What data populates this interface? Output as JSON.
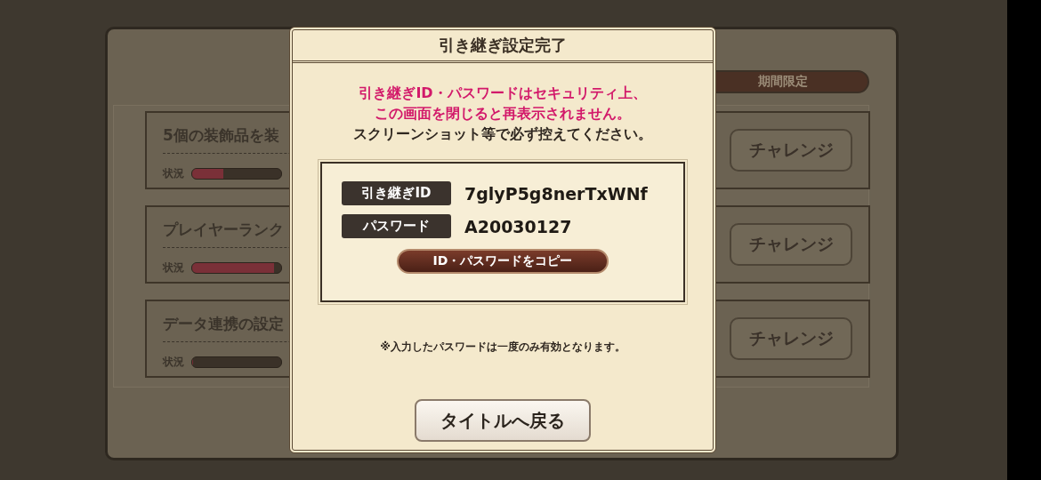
{
  "background": {
    "tab": {
      "label": "期間限定",
      "selected": true
    },
    "missions": [
      {
        "title": "5個の装飾品を装",
        "status_label": "状況",
        "level": 0.35,
        "button": "チャレンジ"
      },
      {
        "title": "プレイヤーランク",
        "status_label": "状況",
        "level": 0.92,
        "button": "チャレンジ"
      },
      {
        "title": "データ連携の設定",
        "status_label": "状況",
        "level": 0,
        "button": "チャレンジ"
      }
    ]
  },
  "dialog": {
    "title": "引き継ぎ設定完了",
    "warning_lines": [
      "引き継ぎID・パスワードはセキュリティ上、",
      "この画面を閉じると再表示されません。"
    ],
    "instruction": "スクリーンショット等で必ず控えてください。",
    "credentials": [
      {
        "label": "引き継ぎID",
        "value": "7glyP5g8nerTxWNf"
      },
      {
        "label": "パスワード",
        "value": "A20030127"
      }
    ],
    "copy_button": "ID・パスワードをコピー",
    "note": "※入力したパスワードは一度のみ有効となります。",
    "back_button": "タイトルへ戻る"
  }
}
